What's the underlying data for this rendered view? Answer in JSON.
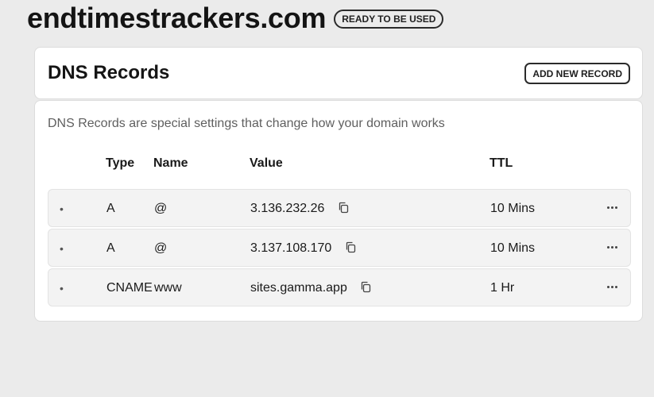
{
  "domain": {
    "name": "endtimestrackers.com",
    "status": "READY TO BE USED"
  },
  "dns": {
    "title": "DNS Records",
    "add_label": "ADD NEW RECORD",
    "description": "DNS Records are special settings that change how your domain works",
    "columns": {
      "type": "Type",
      "name": "Name",
      "value": "Value",
      "ttl": "TTL"
    },
    "records": [
      {
        "bullet": "•",
        "type": "A",
        "name": "@",
        "value": "3.136.232.26",
        "ttl": "10 Mins"
      },
      {
        "bullet": "•",
        "type": "A",
        "name": "@",
        "value": "3.137.108.170",
        "ttl": "10 Mins"
      },
      {
        "bullet": "•",
        "type": "CNAME",
        "name": "www",
        "value": "sites.gamma.app",
        "ttl": "1 Hr"
      }
    ]
  },
  "icons": {
    "copy": "copy-icon",
    "more": "more-options-icon"
  }
}
